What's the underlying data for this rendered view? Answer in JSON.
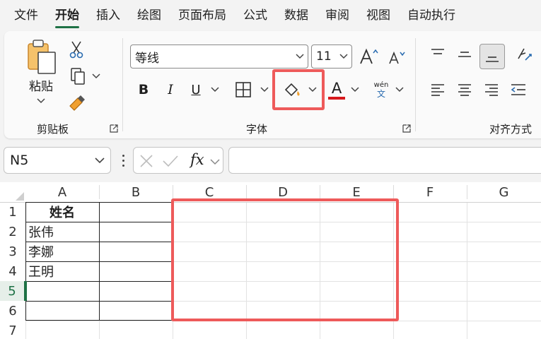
{
  "menu": {
    "tabs": [
      "文件",
      "开始",
      "插入",
      "绘图",
      "页面布局",
      "公式",
      "数据",
      "审阅",
      "视图",
      "自动执行"
    ],
    "active_index": 1
  },
  "ribbon": {
    "clipboard": {
      "paste_label": "粘贴",
      "group_label": "剪贴板"
    },
    "font": {
      "font_name": "等线",
      "font_size": "11",
      "bold": "B",
      "italic": "I",
      "underline": "U",
      "font_color_letter": "A",
      "phonetic_top": "wén",
      "phonetic_bottom": "文",
      "group_label": "字体"
    },
    "alignment": {
      "group_label": "对齐方式"
    }
  },
  "formula_bar": {
    "name_box": "N5",
    "fx_label": "fx",
    "formula": ""
  },
  "sheet": {
    "columns": [
      "A",
      "B",
      "C",
      "D",
      "E",
      "F",
      "G"
    ],
    "rows": [
      "1",
      "2",
      "3",
      "4",
      "5",
      "6",
      "7"
    ],
    "cells": {
      "A1": "姓名",
      "A2": "张伟",
      "A3": "李娜",
      "A4": "王明"
    },
    "active_row": "5"
  },
  "colors": {
    "accent": "#1e7145",
    "highlight": "#ee5a5a",
    "font_color_bar": "#d7191c"
  }
}
